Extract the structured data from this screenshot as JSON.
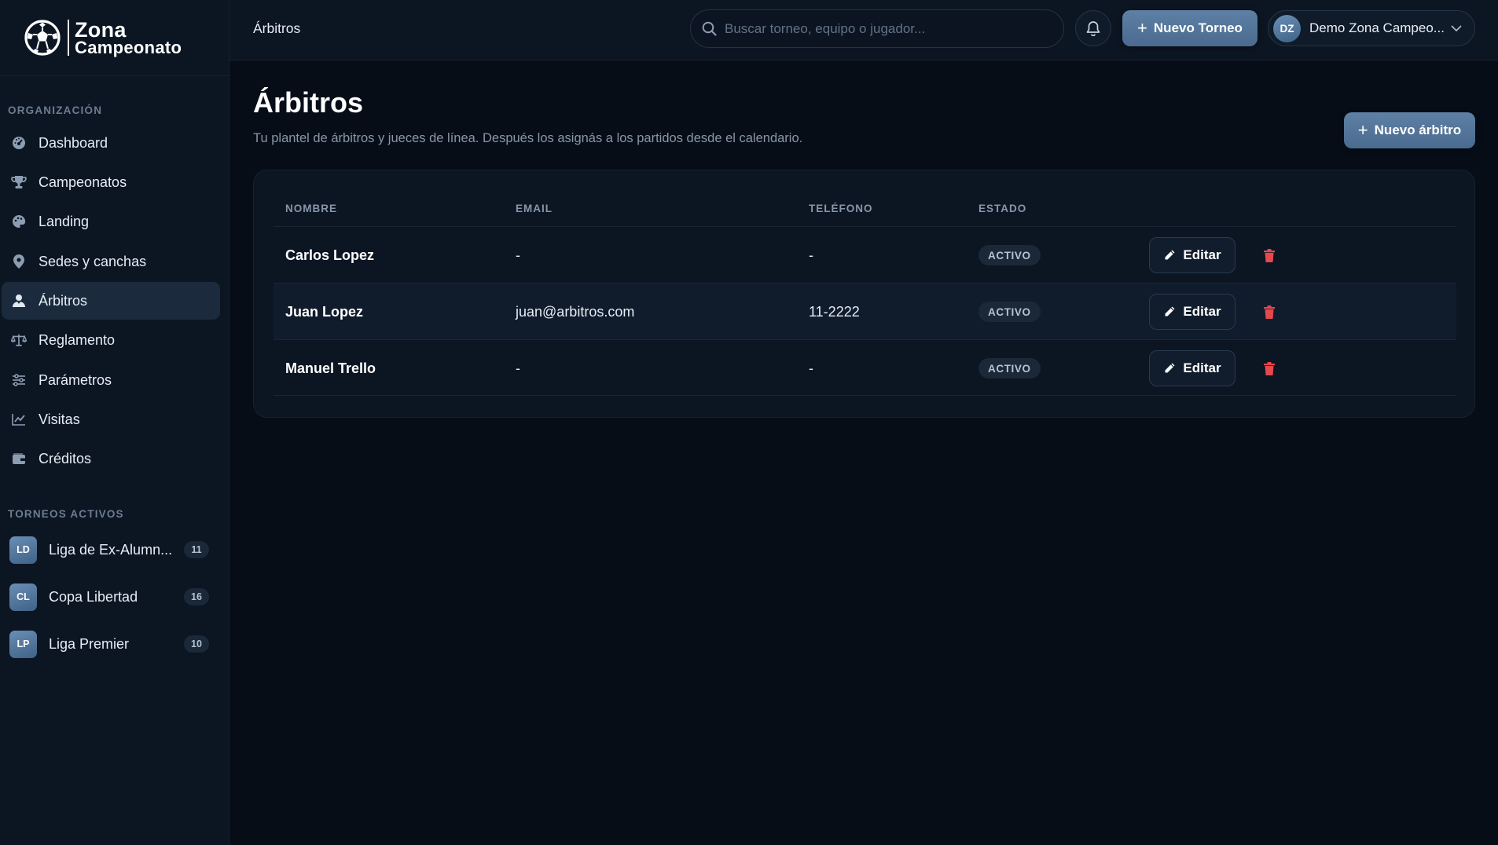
{
  "brand": {
    "line1": "Zona",
    "line2": "Campeonato"
  },
  "sidebar": {
    "section_org": "ORGANIZACIÓN",
    "items": [
      {
        "label": "Dashboard",
        "icon": "dashboard-icon"
      },
      {
        "label": "Campeonatos",
        "icon": "trophy-icon"
      },
      {
        "label": "Landing",
        "icon": "palette-icon"
      },
      {
        "label": "Sedes y canchas",
        "icon": "location-pin-icon"
      },
      {
        "label": "Árbitros",
        "icon": "referee-icon",
        "active": true
      },
      {
        "label": "Reglamento",
        "icon": "scale-icon"
      },
      {
        "label": "Parámetros",
        "icon": "sliders-icon"
      },
      {
        "label": "Visitas",
        "icon": "chart-line-icon"
      },
      {
        "label": "Créditos",
        "icon": "wallet-icon"
      }
    ],
    "section_tournaments": "TORNEOS ACTIVOS",
    "tournaments": [
      {
        "initials": "LD",
        "name": "Liga de Ex-Alumn...",
        "count": "11"
      },
      {
        "initials": "CL",
        "name": "Copa Libertad",
        "count": "16"
      },
      {
        "initials": "LP",
        "name": "Liga Premier",
        "count": "10"
      }
    ]
  },
  "topbar": {
    "breadcrumb": "Árbitros",
    "search_placeholder": "Buscar torneo, equipo o jugador...",
    "new_tournament": "Nuevo Torneo",
    "user_initials": "DZ",
    "user_name": "Demo Zona Campeo..."
  },
  "main": {
    "title": "Árbitros",
    "subtitle": "Tu plantel de árbitros y jueces de línea. Después los asignás a los partidos desde el calendario.",
    "new_button": "Nuevo árbitro",
    "columns": {
      "name": "NOMBRE",
      "email": "EMAIL",
      "phone": "TELÉFONO",
      "status": "ESTADO"
    },
    "rows": [
      {
        "name": "Carlos Lopez",
        "email": "-",
        "phone": "-",
        "status": "ACTIVO",
        "edit": "Editar"
      },
      {
        "name": "Juan Lopez",
        "email": "juan@arbitros.com",
        "phone": "11-2222",
        "status": "ACTIVO",
        "edit": "Editar"
      },
      {
        "name": "Manuel Trello",
        "email": "-",
        "phone": "-",
        "status": "ACTIVO",
        "edit": "Editar"
      }
    ]
  },
  "colors": {
    "background": "#070d17",
    "panel": "#0c1522",
    "accent": "#5e80a5",
    "danger": "#e5484d"
  }
}
